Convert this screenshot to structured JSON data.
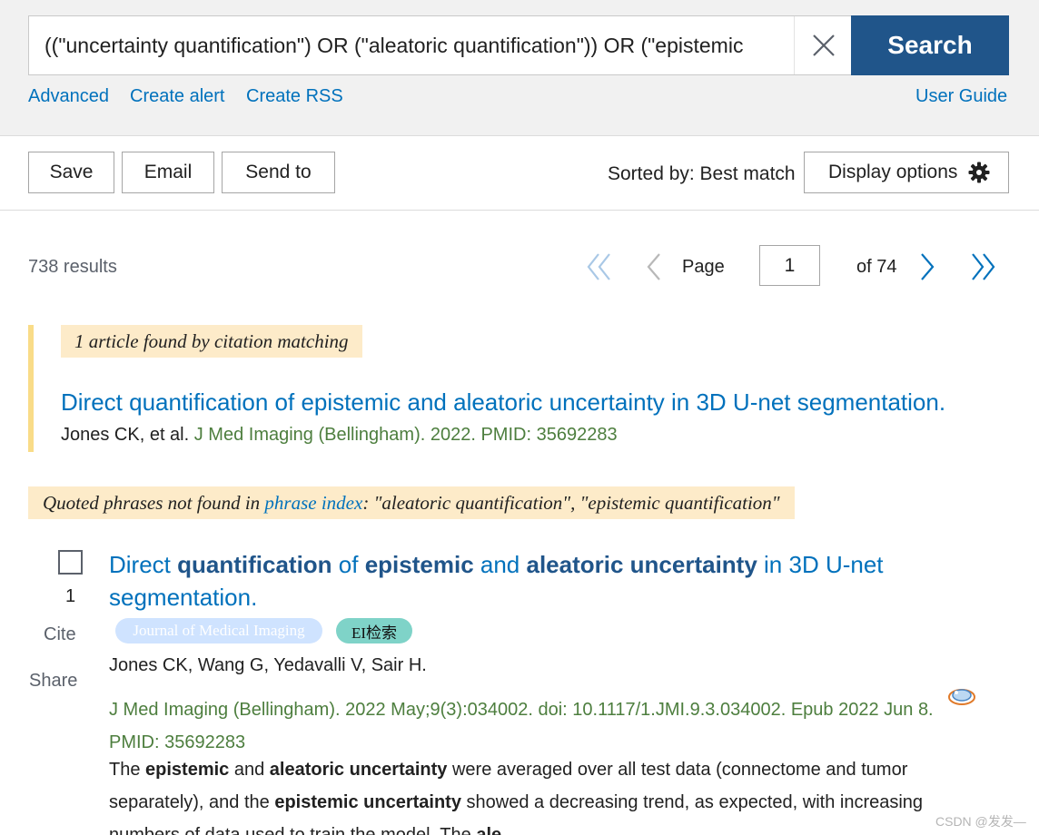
{
  "search": {
    "query": "((\"uncertainty quantification\") OR (\"aleatoric quantification\")) OR (\"epistemic",
    "button_label": "Search",
    "links": [
      "Advanced",
      "Create alert",
      "Create RSS"
    ],
    "user_guide": "User Guide"
  },
  "toolbar": {
    "save_label": "Save",
    "email_label": "Email",
    "send_to_label": "Send to",
    "sorted_by": "Sorted by: Best match",
    "display_options_label": "Display options"
  },
  "results": {
    "count_text": "738 results",
    "page_label": "Page",
    "current_page": "1",
    "of_pages": "of 74"
  },
  "citation_match": {
    "banner": "1 article found by citation matching",
    "title": "Direct quantification of epistemic and aleatoric uncertainty in 3D U-net segmentation.",
    "authors": "Jones CK, et al.",
    "journal": "J Med Imaging (Bellingham). 2022. PMID: 35692283"
  },
  "quoted_notice": {
    "prefix": "Quoted phrases not found in ",
    "link": "phrase index",
    "suffix": ": \"aleatoric quantification\", \"epistemic quantification\""
  },
  "article": {
    "number": "1",
    "cite_label": "Cite",
    "share_label": "Share",
    "title_parts": [
      "Direct ",
      "quantification",
      " of ",
      "epistemic",
      " and ",
      "aleatoric uncertainty",
      " in 3D U-net segmentation."
    ],
    "tags": [
      "Journal of Medical Imaging",
      "EI检索"
    ],
    "authors": "Jones CK, Wang G, Yedavalli V, Sair H.",
    "journal_line": "J Med Imaging (Bellingham). 2022 May;9(3):034002. doi: 10.1117/1.JMI.9.3.034002. Epub 2022 Jun 8.",
    "pmid_line": "PMID: 35692283",
    "snippet_parts": [
      "The ",
      "epistemic",
      " and ",
      "aleatoric uncertainty",
      " were averaged over all test data (connectome and tumor separately), and the ",
      "epistemic uncertainty",
      " showed a decreasing trend, as expected, with increasing numbers of data used to train the model. The ",
      "ale"
    ]
  },
  "watermark": "CSDN @发发—",
  "colors": {
    "link_blue": "#0071bc",
    "search_button": "#20558a",
    "journal_green": "#4d7e3e",
    "highlight_bg": "#fdebc9",
    "citation_border": "#f9dc88",
    "tag_journal_bg": "#cfe3ff",
    "tag_ei_bg": "#7fd3c8"
  }
}
